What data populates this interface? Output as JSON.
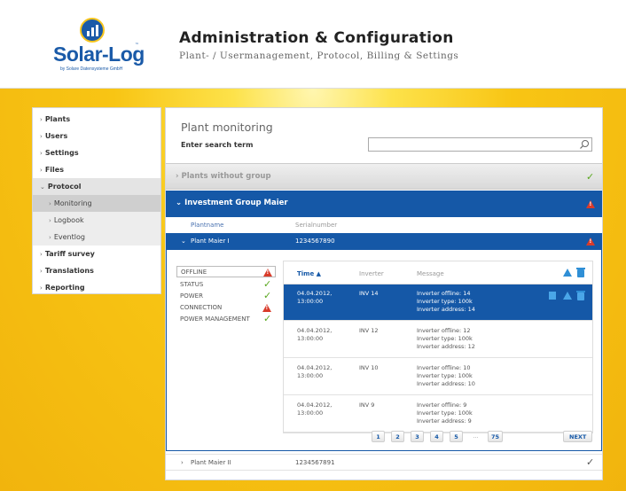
{
  "header": {
    "logo_text": "Solar-Log",
    "logo_tm": "™",
    "logo_sub": "by Solare Datensysteme GmbH",
    "title": "Administration & Configuration",
    "subtitle": "Plant- / Usermanagement, Protocol, Billing & Settings"
  },
  "sidebar": {
    "items": [
      {
        "label": "Plants",
        "arrow": "›"
      },
      {
        "label": "Users",
        "arrow": "›"
      },
      {
        "label": "Settings",
        "arrow": "›"
      },
      {
        "label": "Files",
        "arrow": "›"
      },
      {
        "label": "Protocol",
        "arrow": "⌄"
      },
      {
        "label": "Tariff survey",
        "arrow": "›"
      },
      {
        "label": "Translations",
        "arrow": "›"
      },
      {
        "label": "Reporting",
        "arrow": "›"
      }
    ],
    "protocol_sub": [
      {
        "label": "Monitoring",
        "arrow": "›",
        "active": true
      },
      {
        "label": "Logbook",
        "arrow": "›"
      },
      {
        "label": "Eventlog",
        "arrow": "›"
      }
    ]
  },
  "main": {
    "title": "Plant monitoring",
    "search_label": "Enter search term",
    "search_value": "",
    "search_placeholder": "",
    "groups": [
      {
        "label": "Plants without group",
        "arrow": "›",
        "status": "ok"
      },
      {
        "label": "Investment Group Maier",
        "arrow": "⌄",
        "status": "warning"
      }
    ],
    "columns": {
      "plantname": "Plantname",
      "serialnumber": "Serialnumber"
    },
    "plants": [
      {
        "name": "Plant Maier I",
        "arrow": "⌄",
        "serial": "1234567890",
        "status": "warning"
      },
      {
        "name": "Plant Maier II",
        "arrow": "›",
        "serial": "1234567891",
        "status": "ok"
      }
    ],
    "status_panel": [
      {
        "label": "OFFLINE",
        "status": "warning"
      },
      {
        "label": "STATUS",
        "status": "ok"
      },
      {
        "label": "POWER",
        "status": "ok"
      },
      {
        "label": "CONNECTION",
        "status": "warning"
      },
      {
        "label": "POWER MANAGEMENT",
        "status": "ok"
      }
    ],
    "table": {
      "headers": {
        "time": "Time ▲",
        "inverter": "Inverter",
        "message": "Message"
      },
      "rows": [
        {
          "time": "04.04.2012,\n13:00:00",
          "inverter": "INV 14",
          "message": "Inverter offline: 14\nInverter type: 100k\nInverter address: 14",
          "selected": true
        },
        {
          "time": "04.04.2012,\n13:00:00",
          "inverter": "INV 12",
          "message": "Inverter offline: 12\nInverter type: 100k\nInverter address: 12",
          "selected": false
        },
        {
          "time": "04.04.2012,\n13:00:00",
          "inverter": "INV 10",
          "message": "Inverter offline: 10\nInverter type: 100k\nInverter address: 10",
          "selected": false
        },
        {
          "time": "04.04.2012,\n13:00:00",
          "inverter": "INV 9",
          "message": "Inverter offline: 9\nInverter type: 100k\nInverter address: 9",
          "selected": false
        }
      ]
    },
    "pager": {
      "pages": [
        "1",
        "2",
        "3",
        "4",
        "5"
      ],
      "ellipsis": "...",
      "last": "75",
      "next": "NEXT"
    }
  },
  "colors": {
    "accent_blue": "#1558a7",
    "ok_green": "#5aa81f",
    "warn_red": "#d93b2a",
    "yellow": "#f8c514"
  },
  "icons": {
    "ok": "check-icon",
    "warning": "warning-triangle-icon",
    "table_actions": [
      "warning-triangle-icon",
      "trash-icon",
      "document-icon"
    ]
  }
}
